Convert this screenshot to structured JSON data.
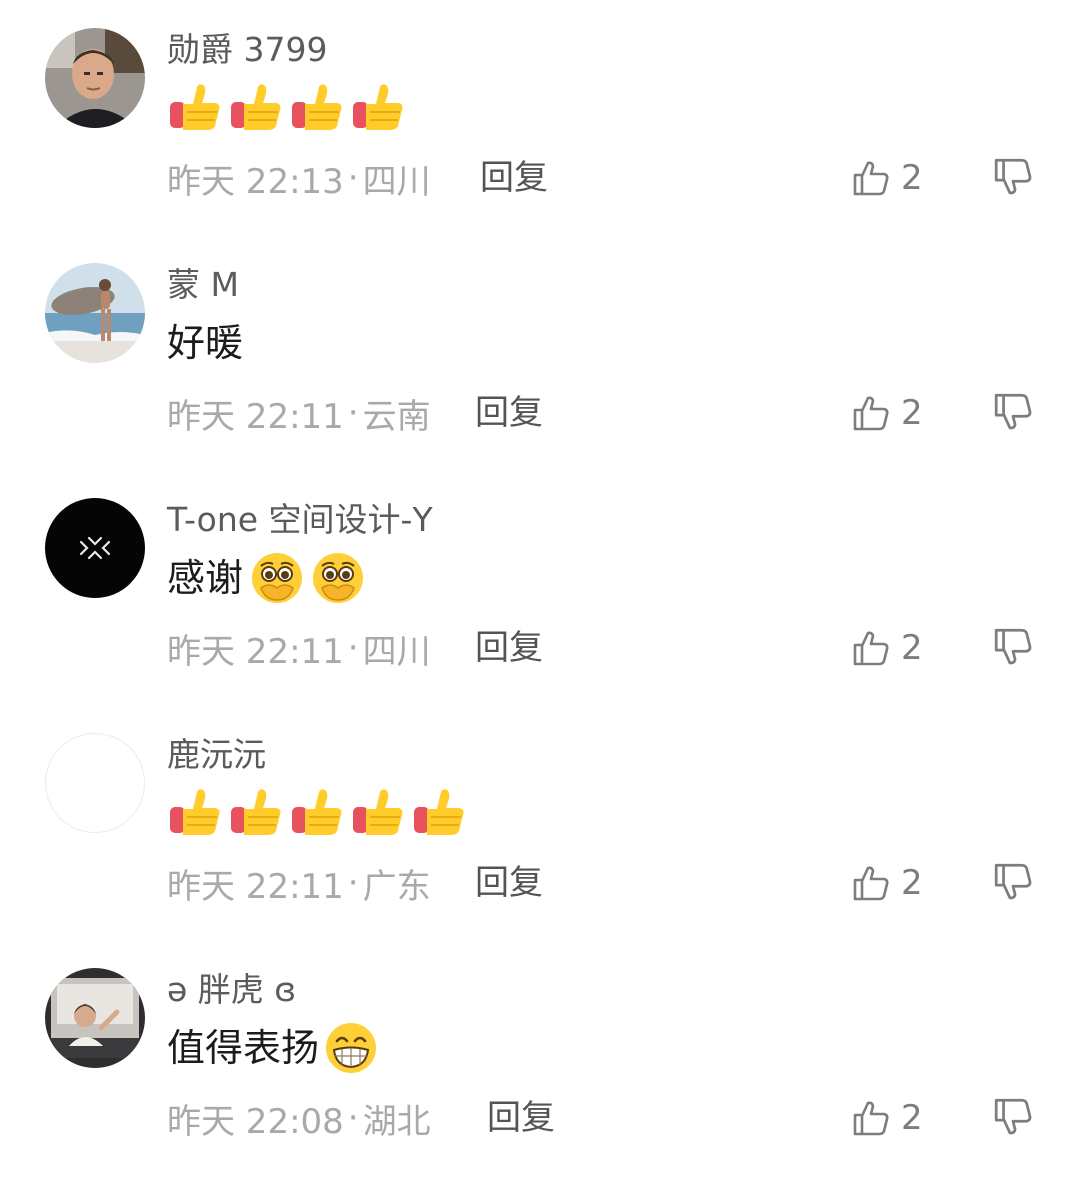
{
  "colors": {
    "username": "#5b5b5b",
    "content": "#1c1c1c",
    "meta": "#a9a9a9",
    "reply": "#545454",
    "icon": "#7d7d7d",
    "thumbs_emoji_yellow": "#ffcc2a",
    "thumbs_emoji_cuff": "#e8525f"
  },
  "comments": [
    {
      "username": "勋爵 3799",
      "text": "",
      "emojis": [
        "thumbs-up-emoji",
        "thumbs-up-emoji",
        "thumbs-up-emoji",
        "thumbs-up-emoji"
      ],
      "time": "昨天 22:13",
      "location": "四川",
      "reply_label": "回复",
      "likes": "2",
      "avatar": "avatar-man-photo"
    },
    {
      "username": "蒙 M",
      "text": "好暖",
      "emojis": [],
      "time": "昨天 22:11",
      "location": "云南",
      "reply_label": "回复",
      "likes": "2",
      "avatar": "avatar-surfboard-photo"
    },
    {
      "username": "T-one 空间设计-Y",
      "text": "感谢",
      "emojis": [
        "touched-face-emoji",
        "touched-face-emoji"
      ],
      "time": "昨天 22:11",
      "location": "四川",
      "reply_label": "回复",
      "likes": "2",
      "avatar": "avatar-black-logo"
    },
    {
      "username": "鹿沅沅",
      "text": "",
      "emojis": [
        "thumbs-up-emoji",
        "thumbs-up-emoji",
        "thumbs-up-emoji",
        "thumbs-up-emoji",
        "thumbs-up-emoji"
      ],
      "time": "昨天 22:11",
      "location": "广东",
      "reply_label": "回复",
      "likes": "2",
      "avatar": "avatar-blank"
    },
    {
      "username": "ə 胖虎 ɞ",
      "text": "值得表扬",
      "emojis": [
        "grin-emoji"
      ],
      "time": "昨天 22:08",
      "location": "湖北",
      "reply_label": "回复",
      "likes": "2",
      "avatar": "avatar-person-photo"
    }
  ]
}
